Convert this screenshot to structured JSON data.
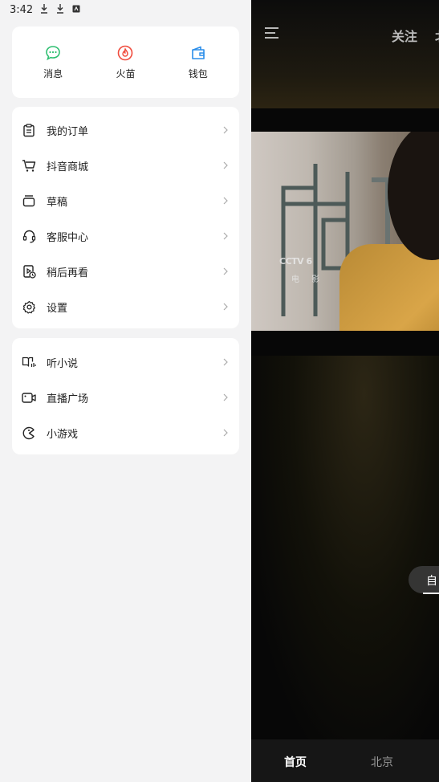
{
  "status_bar": {
    "time": "3:42",
    "icons": [
      "download-icon",
      "download-icon",
      "sim-icon"
    ]
  },
  "quick_actions": [
    {
      "label": "消息",
      "icon": "message-icon",
      "color": "#2fbf71"
    },
    {
      "label": "火苗",
      "icon": "flame-icon",
      "color": "#f04b3d"
    },
    {
      "label": "钱包",
      "icon": "wallet-icon",
      "color": "#2b8eea"
    }
  ],
  "menu_group_1": [
    {
      "label": "我的订单",
      "icon": "order-icon"
    },
    {
      "label": "抖音商城",
      "icon": "cart-icon"
    },
    {
      "label": "草稿",
      "icon": "drafts-icon"
    },
    {
      "label": "客服中心",
      "icon": "headset-icon"
    },
    {
      "label": "稍后再看",
      "icon": "watch-later-icon"
    },
    {
      "label": "设置",
      "icon": "gear-icon"
    }
  ],
  "menu_group_2": [
    {
      "label": "听小说",
      "icon": "audiobook-icon"
    },
    {
      "label": "直播广场",
      "icon": "live-icon"
    },
    {
      "label": "小游戏",
      "icon": "game-icon"
    }
  ],
  "feed": {
    "tab_follow": "关注",
    "tab_next_partial": "北",
    "video_logo": "CCTV 6",
    "video_logo_sub": "电 影",
    "pill_text": "自",
    "bottom_nav": {
      "home": "首页",
      "city": "北京"
    }
  }
}
